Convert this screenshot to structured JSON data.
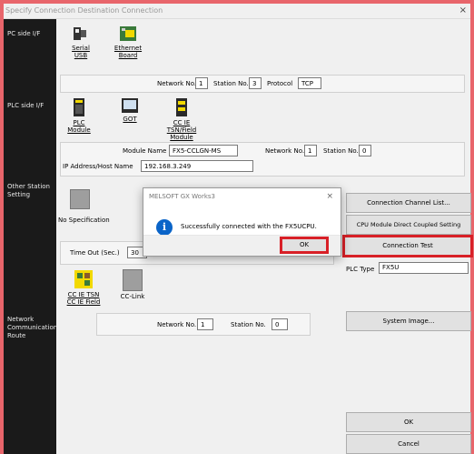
{
  "window": {
    "title": "Specify Connection Destination Connection",
    "close": "×"
  },
  "left": {
    "pc_if": "PC side I/F",
    "plc_if": "PLC side I/F",
    "other_station": "Other Station Setting",
    "network_route": "Network Communication Route"
  },
  "pc_side": {
    "serial_usb": "Serial USB",
    "ethernet_board": "Ethernet Board",
    "network_no_label": "Network No.",
    "network_no_value": "1",
    "station_no_label": "Station No.",
    "station_no_value": "3",
    "protocol_label": "Protocol",
    "protocol_value": "TCP"
  },
  "plc_side": {
    "plc_module": "PLC Module",
    "got": "GOT",
    "cc_ie_tsn": "CC IE TSN/Field Module",
    "module_name_label": "Module Name",
    "module_name_value": "FX5-CCLGN-MS",
    "network_no_label": "Network No.",
    "network_no_value": "1",
    "station_no_label": "Station No.",
    "station_no_value": "0",
    "ip_label": "IP Address/Host Name",
    "ip_value": "192.168.3.249"
  },
  "other": {
    "no_specification": "No Specification",
    "timeout_label": "Time Out (Sec.)",
    "timeout_value": "30"
  },
  "route": {
    "cc_ie_tsn_field": "CC IE TSN CC IE Field",
    "cc_link": "CC-Link",
    "network_no_label": "Network No.",
    "network_no_value": "1",
    "station_no_label": "Station No.",
    "station_no_value": "0"
  },
  "right": {
    "connection_channel_list": "Connection Channel List...",
    "cpu_module_direct": "CPU Module Direct Coupled Setting",
    "connection_test": "Connection Test",
    "plc_type_label": "PLC Type",
    "plc_type_value": "FX5U",
    "system_image": "System Image...",
    "ok": "OK",
    "cancel": "Cancel"
  },
  "dialog": {
    "title": "MELSOFT GX Works3",
    "close": "×",
    "info": "i",
    "message": "Successfully connected with the FX5UCPU.",
    "ok": "OK"
  },
  "colors": {
    "frame": "#e8656b",
    "highlight": "#d82027",
    "info_icon": "#0a64c8"
  }
}
